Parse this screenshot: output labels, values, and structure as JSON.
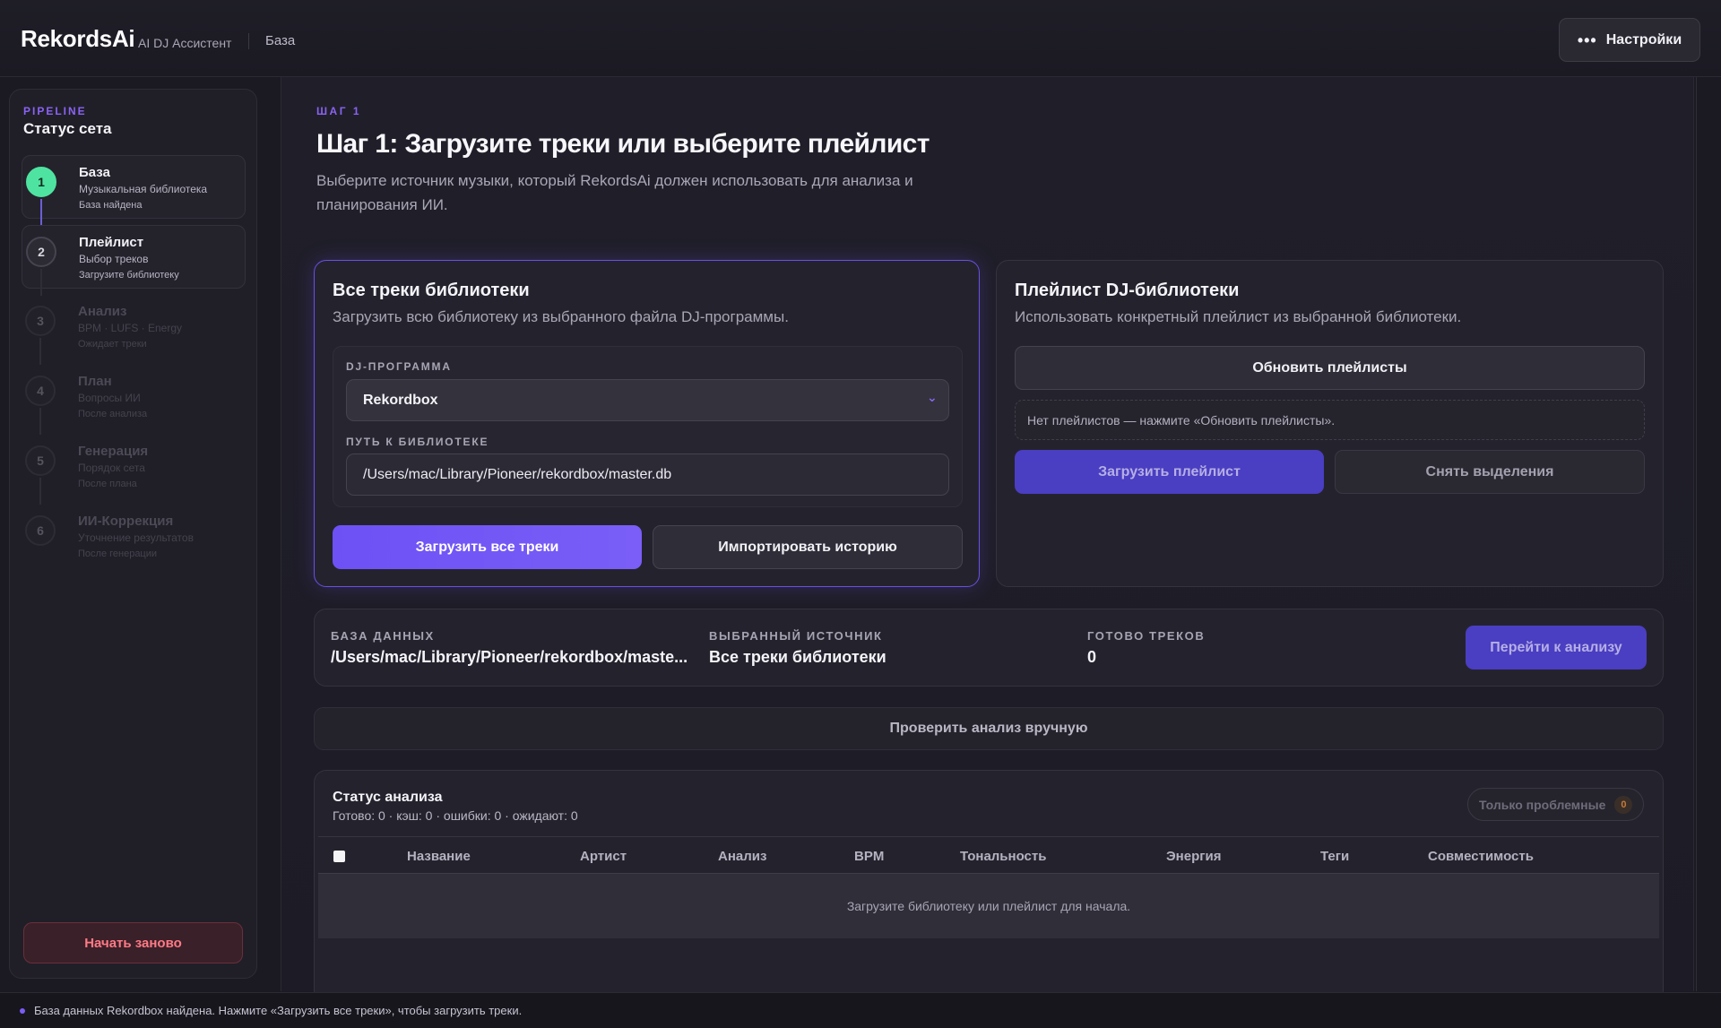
{
  "header": {
    "brand": "RekordsAi",
    "subtitle": "AI DJ Ассистент",
    "breadcrumb": "База",
    "settings_label": "Настройки",
    "settings_icon": "more-dots-icon"
  },
  "sidebar": {
    "kicker": "PIPELINE",
    "title": "Статус сета",
    "steps": [
      {
        "num": "1",
        "name": "База",
        "desc": "Музыкальная библиотека",
        "status": "База найдена",
        "state": "done"
      },
      {
        "num": "2",
        "name": "Плейлист",
        "desc": "Выбор треков",
        "status": "Загрузите библиотеку",
        "state": "active"
      },
      {
        "num": "3",
        "name": "Анализ",
        "desc": "BPM · LUFS · Energy",
        "status": "Ожидает треки",
        "state": "pending"
      },
      {
        "num": "4",
        "name": "План",
        "desc": "Вопросы ИИ",
        "status": "После анализа",
        "state": "pending"
      },
      {
        "num": "5",
        "name": "Генерация",
        "desc": "Порядок сета",
        "status": "После плана",
        "state": "pending"
      },
      {
        "num": "6",
        "name": "ИИ-Коррекция",
        "desc": "Уточнение результатов",
        "status": "После генерации",
        "state": "pending"
      }
    ],
    "restart_label": "Начать заново"
  },
  "main": {
    "kicker": "ШАГ 1",
    "title": "Шаг 1: Загрузите треки или выберите плейлист",
    "subtitle": "Выберите источник музыки, который RekordsAi должен использовать для анализа и планирования ИИ."
  },
  "all_tracks": {
    "title": "Все треки библиотеки",
    "subtitle": "Загрузить всю библиотеку из выбранного файла DJ-программы.",
    "program_label": "DJ-ПРОГРАММА",
    "program_value": "Rekordbox",
    "path_label": "ПУТЬ К БИБЛИОТЕКЕ",
    "path_value": "/Users/mac/Library/Pioneer/rekordbox/master.db",
    "load_all_label": "Загрузить все треки",
    "import_history_label": "Импортировать историю"
  },
  "playlist": {
    "title": "Плейлист DJ-библиотеки",
    "subtitle": "Использовать конкретный плейлист из выбранной библиотеки.",
    "refresh_label": "Обновить плейлисты",
    "empty_text": "Нет плейлистов — нажмите «Обновить плейлисты».",
    "load_label": "Загрузить плейлист",
    "clear_label": "Снять выделения"
  },
  "summary": {
    "db_label": "БАЗА ДАННЫХ",
    "db_value": "/Users/mac/Library/Pioneer/rekordbox/maste...",
    "source_label": "ВЫБРАННЫЙ ИСТОЧНИК",
    "source_value": "Все треки библиотеки",
    "ready_label": "ГОТОВО ТРЕКОВ",
    "ready_value": "0",
    "go_label": "Перейти к анализу"
  },
  "manual_check_label": "Проверить анализ вручную",
  "analysis": {
    "title": "Статус анализа",
    "counts": "Готово: 0 · кэш: 0 · ошибки: 0 · ожидают: 0",
    "filter_label": "Только проблемные",
    "filter_count": "0",
    "columns": [
      "Название",
      "Артист",
      "Анализ",
      "BPM",
      "Тональность",
      "Энергия",
      "Теги",
      "Совместимость"
    ],
    "empty_text": "Загрузите библиотеку или плейлист для начала."
  },
  "statusbar": {
    "text": "База данных Rekordbox найдена. Нажмите «Загрузить все треки», чтобы загрузить треки."
  },
  "colors": {
    "accent": "#7a5ef7",
    "success": "#4fe3a1",
    "danger": "#ff7a86",
    "background": "#1b1a22"
  }
}
